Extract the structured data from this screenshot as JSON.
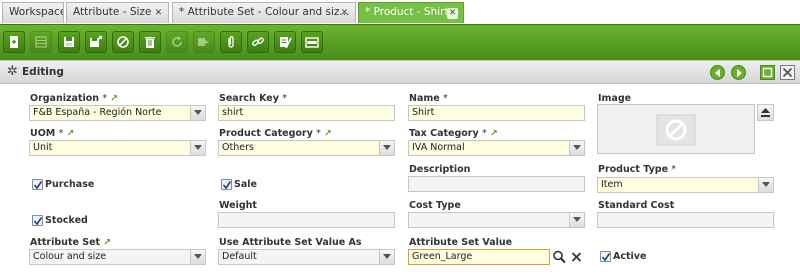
{
  "tabs": [
    {
      "label": "Workspace",
      "closable": false
    },
    {
      "label": "Attribute - Size",
      "closable": true
    },
    {
      "label": "* Attribute Set - Colour and siz...",
      "closable": true
    },
    {
      "label": "* Product - Shirt",
      "closable": true,
      "active": true
    }
  ],
  "toolbar": {
    "buttons": [
      "new-icon",
      "grid-icon",
      "save-icon",
      "save-close-icon",
      "undo-icon",
      "delete-icon",
      "refresh-icon",
      "export-icon",
      "attach-icon",
      "link-icon",
      "tools-icon",
      "audit-icon"
    ]
  },
  "header": {
    "title": "Editing",
    "req_mark": "*"
  },
  "form": {
    "organization": {
      "label": "Organization",
      "value": "F&B España - Región Norte"
    },
    "search_key": {
      "label": "Search Key",
      "value": "shirt"
    },
    "name": {
      "label": "Name",
      "value": "Shirt"
    },
    "image": {
      "label": "Image"
    },
    "uom": {
      "label": "UOM",
      "value": "Unit"
    },
    "product_category": {
      "label": "Product Category",
      "value": "Others"
    },
    "tax_category": {
      "label": "Tax Category",
      "value": "IVA Normal"
    },
    "purchase": {
      "label": "Purchase",
      "checked": true
    },
    "sale": {
      "label": "Sale",
      "checked": true
    },
    "description": {
      "label": "Description",
      "value": ""
    },
    "product_type": {
      "label": "Product Type",
      "value": "Item"
    },
    "stocked": {
      "label": "Stocked",
      "checked": true
    },
    "weight": {
      "label": "Weight",
      "value": ""
    },
    "cost_type": {
      "label": "Cost Type",
      "value": ""
    },
    "standard_cost": {
      "label": "Standard Cost",
      "value": ""
    },
    "attribute_set": {
      "label": "Attribute Set",
      "value": "Colour and size"
    },
    "use_attr_set_value_as": {
      "label": "Use Attribute Set Value As",
      "value": "Default"
    },
    "attribute_set_value": {
      "label": "Attribute Set Value",
      "value": "Green_Large"
    },
    "active": {
      "label": "Active",
      "checked": true
    }
  },
  "colors": {
    "accent": "#76c043",
    "toolbar": "#4a8d1b",
    "required_bg": "#fffde0"
  }
}
